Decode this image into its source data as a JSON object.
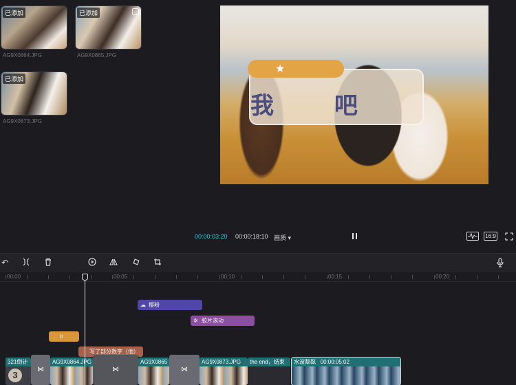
{
  "library": {
    "items": [
      {
        "badge": "已添加",
        "name": "AG9X0864.JPG"
      },
      {
        "badge": "已添加",
        "name": "AG9X0865.JPG"
      },
      {
        "badge": "已添加",
        "name": "AG9X0873.JPG"
      }
    ]
  },
  "preview": {
    "title_text": "我 吧",
    "current_time": "00:00:03:20",
    "total_time": "00:00:18:10",
    "quality": "画质",
    "ratio": "16:9"
  },
  "ruler": {
    "labels": [
      "00:00",
      "00:05",
      "00:10",
      "00:15",
      "00:20"
    ]
  },
  "tracks": {
    "effect1": "樱粉",
    "effect2": "胶片滚动",
    "text_clip": "Ir",
    "text_clip2": "写了部分数字（他）"
  },
  "main_track": {
    "seg0": "321倒计",
    "seg0_count": "3",
    "seg1": "AG9X0864.JPG",
    "seg2": "AG9X0865",
    "seg3": "AG9X0873.JPG",
    "seg4": "the end，结束",
    "seg5": "水波粼粼",
    "seg5_time": "00:00:05:02"
  },
  "colors": {
    "accent": "#26c6da",
    "effect_purple": "#4f46a8",
    "effect_pink": "#8a4fa3",
    "text_orange": "#d9973b",
    "track_teal": "#1f6f73"
  }
}
